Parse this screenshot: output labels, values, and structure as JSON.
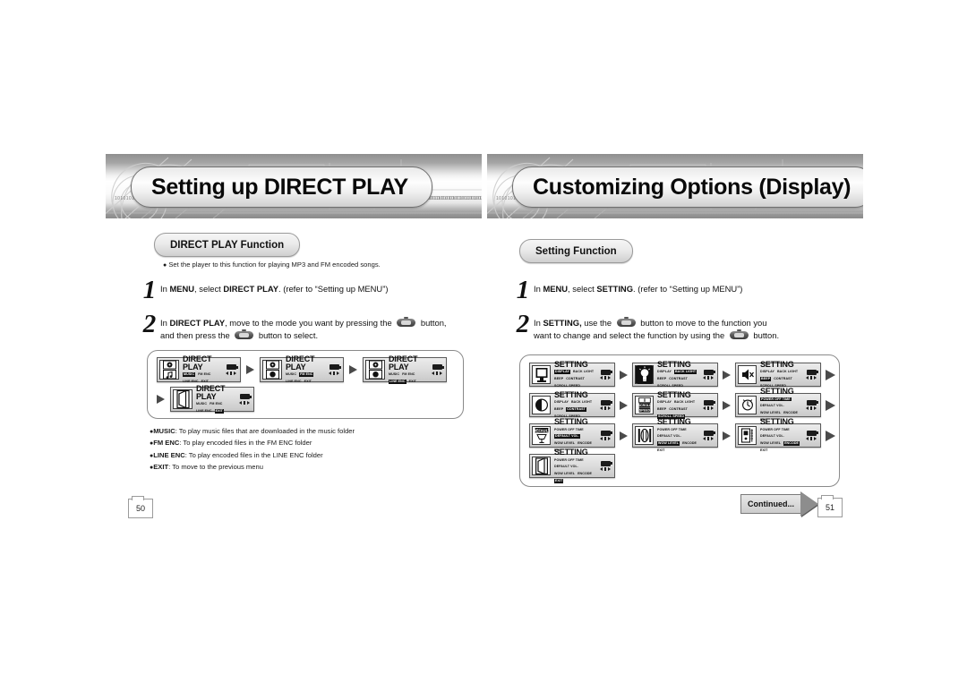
{
  "left_page": {
    "banner_title": "Setting up DIRECT PLAY",
    "section_tag": "DIRECT PLAY Function",
    "intro_bullet": "Set the player to this function for playing MP3 and FM encoded songs.",
    "steps": [
      {
        "num": "1",
        "pre": "In ",
        "b1": "MENU",
        "mid": ", select ",
        "b2": "DIRECT PLAY",
        "post": ". (refer to “Setting up MENU”)"
      },
      {
        "num": "2",
        "line1_pre": "In ",
        "line1_b": "DIRECT PLAY",
        "line1_mid": ", move to the mode you want by pressing the ",
        "line1_post": " button,",
        "line2_pre": "and then press the ",
        "line2_post": " button to select."
      }
    ],
    "lcd_title": "DIRECT PLAY",
    "lcd_items": [
      "MUSIC",
      "FM ENC",
      "LINE ENC",
      "EXIT"
    ],
    "lcd_screens": [
      {
        "icon": "music-cd-icon",
        "selected": "MUSIC"
      },
      {
        "icon": "fm-radio-icon",
        "selected": "FM ENC"
      },
      {
        "icon": "line-in-icon",
        "selected": "LINE ENC"
      },
      {
        "icon": "exit-door-icon",
        "selected": "EXIT"
      }
    ],
    "notes": [
      {
        "term": "MUSIC",
        "desc": ": To play music files that are downloaded in the music folder"
      },
      {
        "term": "FM ENC",
        "desc": ": To play encoded files in the FM ENC folder"
      },
      {
        "term": "LINE ENC",
        "desc": ": To play encoded files in the LINE ENC folder"
      },
      {
        "term": "EXIT",
        "desc": ": To move to the previous menu"
      }
    ],
    "page_number": "50"
  },
  "right_page": {
    "banner_title": "Customizing Options (Display)",
    "section_tag": "Setting Function",
    "steps": [
      {
        "num": "1",
        "pre": "In ",
        "b1": "MENU",
        "mid": ", select ",
        "b2": "SETTING",
        "post": ". (refer to “Setting up MENU”)"
      },
      {
        "num": "2",
        "line1_pre": "In ",
        "line1_b": "SETTING,",
        "line1_mid": " use the ",
        "line1_post": " button to move to the function you",
        "line2_pre": "want to change and select the function by using the ",
        "line2_post": " button."
      }
    ],
    "lcd_title": "SETTING",
    "menu_set_a": [
      "DISPLAY",
      "BACK LIGHT",
      "BEEP",
      "CONTRAST",
      "SCROLL SPEED"
    ],
    "menu_set_b": [
      "POWER OFF TIME",
      "DEFAULT VOL.",
      "WOW LEVEL",
      "ENCODE",
      "EXIT"
    ],
    "lcd_screens": [
      {
        "icon": "monitor-icon",
        "set": "a",
        "selected": "DISPLAY"
      },
      {
        "icon": "backlight-bulb-icon",
        "set": "a",
        "selected": "BACK LIGHT"
      },
      {
        "icon": "beep-mute-icon",
        "set": "a",
        "selected": "BEEP"
      },
      {
        "icon": "contrast-icon",
        "set": "a",
        "selected": "CONTRAST"
      },
      {
        "icon": "scroll-speed-icon",
        "set": "a",
        "selected": "SCROLL SPEED"
      },
      {
        "icon": "power-off-time-icon",
        "set": "b",
        "selected": "POWER OFF TIME"
      },
      {
        "icon": "default-vol-icon",
        "set": "b",
        "selected": "DEFAULT VOL."
      },
      {
        "icon": "wow-level-icon",
        "set": "b",
        "selected": "WOW LEVEL"
      },
      {
        "icon": "encode-icon",
        "set": "b",
        "selected": "ENCODE"
      },
      {
        "icon": "exit-door-icon",
        "set": "b",
        "selected": "EXIT"
      }
    ],
    "continued_label": "Continued...",
    "page_number": "51"
  },
  "banner_texture": {
    "binary_strip": "1010101001101001010010100110100101001010011010010100101001101001010010100110100101001010011010010100101001101001010010100110100101001010011010010100101001101001010010100110",
    "binary_short": "101010100110100101001010011010010100"
  }
}
